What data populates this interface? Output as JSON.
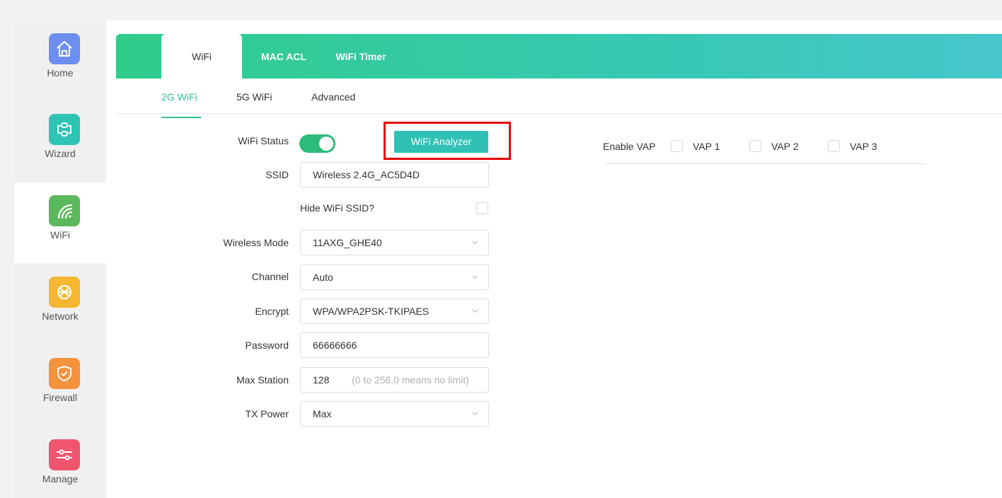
{
  "sidebar": {
    "items": [
      {
        "label": "Home",
        "icon": "home-icon",
        "color": "#6c8ef0",
        "active": false
      },
      {
        "label": "Wizard",
        "icon": "link-icon",
        "color": "#2ec4b6",
        "active": false
      },
      {
        "label": "WiFi",
        "icon": "wifi-icon",
        "color": "#5cb85c",
        "active": true
      },
      {
        "label": "Network",
        "icon": "globe-icon",
        "color": "#f5b731",
        "active": false
      },
      {
        "label": "Firewall",
        "icon": "shield-icon",
        "color": "#f5923e",
        "active": false
      },
      {
        "label": "Manage",
        "icon": "sliders-icon",
        "color": "#f0556e",
        "active": false
      }
    ]
  },
  "tabs": [
    {
      "label": "WiFi",
      "active": true
    },
    {
      "label": "MAC ACL",
      "active": false
    },
    {
      "label": "WiFi Timer",
      "active": false
    }
  ],
  "subtabs": [
    {
      "label": "2G WiFi",
      "active": true
    },
    {
      "label": "5G WiFi",
      "active": false
    },
    {
      "label": "Advanced",
      "active": false
    }
  ],
  "form": {
    "wifi_status": {
      "label": "WiFi Status",
      "enabled": true
    },
    "analyzer_button": "WiFi Analyzer",
    "ssid": {
      "label": "SSID",
      "value": "Wireless 2.4G_AC5D4D"
    },
    "hide_ssid": {
      "label": "Hide WiFi SSID?",
      "checked": false
    },
    "wireless_mode": {
      "label": "Wireless Mode",
      "value": "11AXG_GHE40"
    },
    "channel": {
      "label": "Channel",
      "value": "Auto"
    },
    "encrypt": {
      "label": "Encrypt",
      "value": "WPA/WPA2PSK-TKIPAES"
    },
    "password": {
      "label": "Password",
      "value": "66666666"
    },
    "max_station": {
      "label": "Max Station",
      "value": "128",
      "hint": "(0 to 256,0 means no limit)"
    },
    "tx_power": {
      "label": "TX Power",
      "value": "Max"
    }
  },
  "vap": {
    "label": "Enable VAP",
    "options": [
      {
        "label": "VAP 1",
        "checked": false
      },
      {
        "label": "VAP 2",
        "checked": false
      },
      {
        "label": "VAP 3",
        "checked": false
      }
    ]
  },
  "colors": {
    "accent": "#2fbf9a",
    "toggle_on": "#2dbb7a",
    "button": "#31c1b4",
    "highlight": "#e60000"
  }
}
